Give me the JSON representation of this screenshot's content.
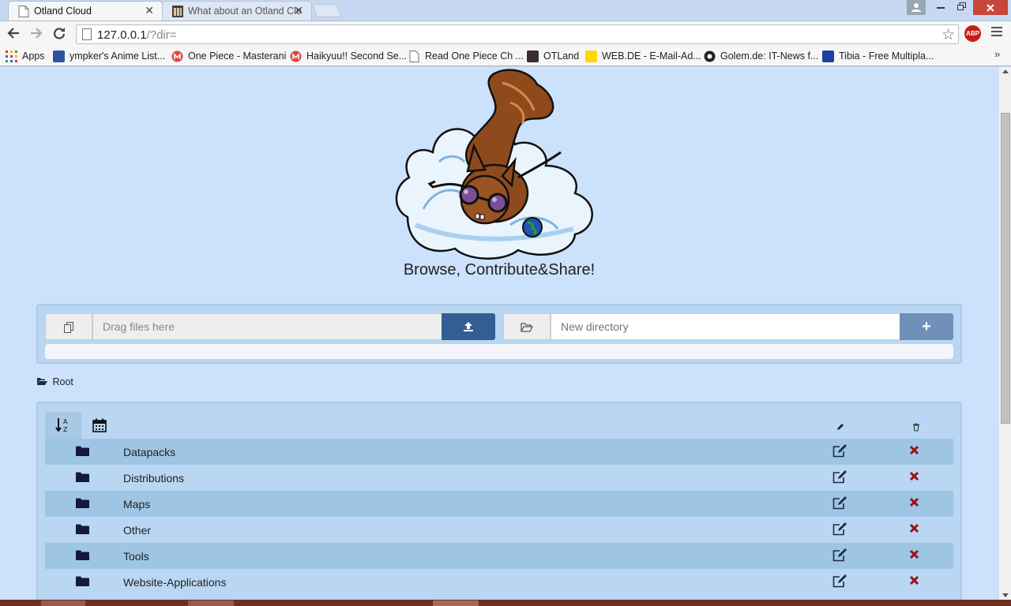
{
  "browser": {
    "tabs": [
      {
        "title": "Otland Cloud",
        "close": "✕"
      },
      {
        "title": "What about an Otland Clo",
        "close": "✕"
      }
    ],
    "address": {
      "host": "127.0.0.1",
      "path": "/?dir="
    },
    "abp_label": "ABP",
    "bookmarks": [
      {
        "label": "Apps",
        "icon": "apps-grid-icon"
      },
      {
        "label": "ympker's Anime List...",
        "icon": "mal-icon"
      },
      {
        "label": "One Piece - Masterani",
        "icon": "masterani-icon"
      },
      {
        "label": "Haikyuu!! Second Se...",
        "icon": "masterani-icon"
      },
      {
        "label": "Read One Piece Ch ...",
        "icon": "page-icon"
      },
      {
        "label": "OTLand",
        "icon": "otland-icon"
      },
      {
        "label": "WEB.DE - E-Mail-Ad...",
        "icon": "webde-icon"
      },
      {
        "label": "Golem.de: IT-News f...",
        "icon": "golem-icon"
      },
      {
        "label": "Tibia - Free Multipla...",
        "icon": "tibia-icon"
      }
    ],
    "bookmarks_more": "»"
  },
  "page": {
    "tagline": "Browse, Contribute&Share!",
    "upload": {
      "drop_placeholder": "Drag files here",
      "dir_placeholder": "New directory",
      "add_label": "+",
      "progress": 0
    },
    "breadcrumb": "Root",
    "sort_icons": [
      "sort-alpha-icon",
      "calendar-icon"
    ],
    "column_icons": {
      "edit": "pencil-icon",
      "delete": "trash-icon"
    },
    "folders": [
      {
        "name": "Datapacks"
      },
      {
        "name": "Distributions"
      },
      {
        "name": "Maps"
      },
      {
        "name": "Other"
      },
      {
        "name": "Tools"
      },
      {
        "name": "Website-Applications"
      }
    ]
  },
  "colors": {
    "page_bg": "#cce1fb",
    "panel_bg": "#b9d6f2",
    "row_stripe": "#9fc5e5",
    "upload_button": "#335e94",
    "add_button": "#6f90b8",
    "delete_icon": "#9b1111",
    "folder_icon": "#131a3a"
  }
}
